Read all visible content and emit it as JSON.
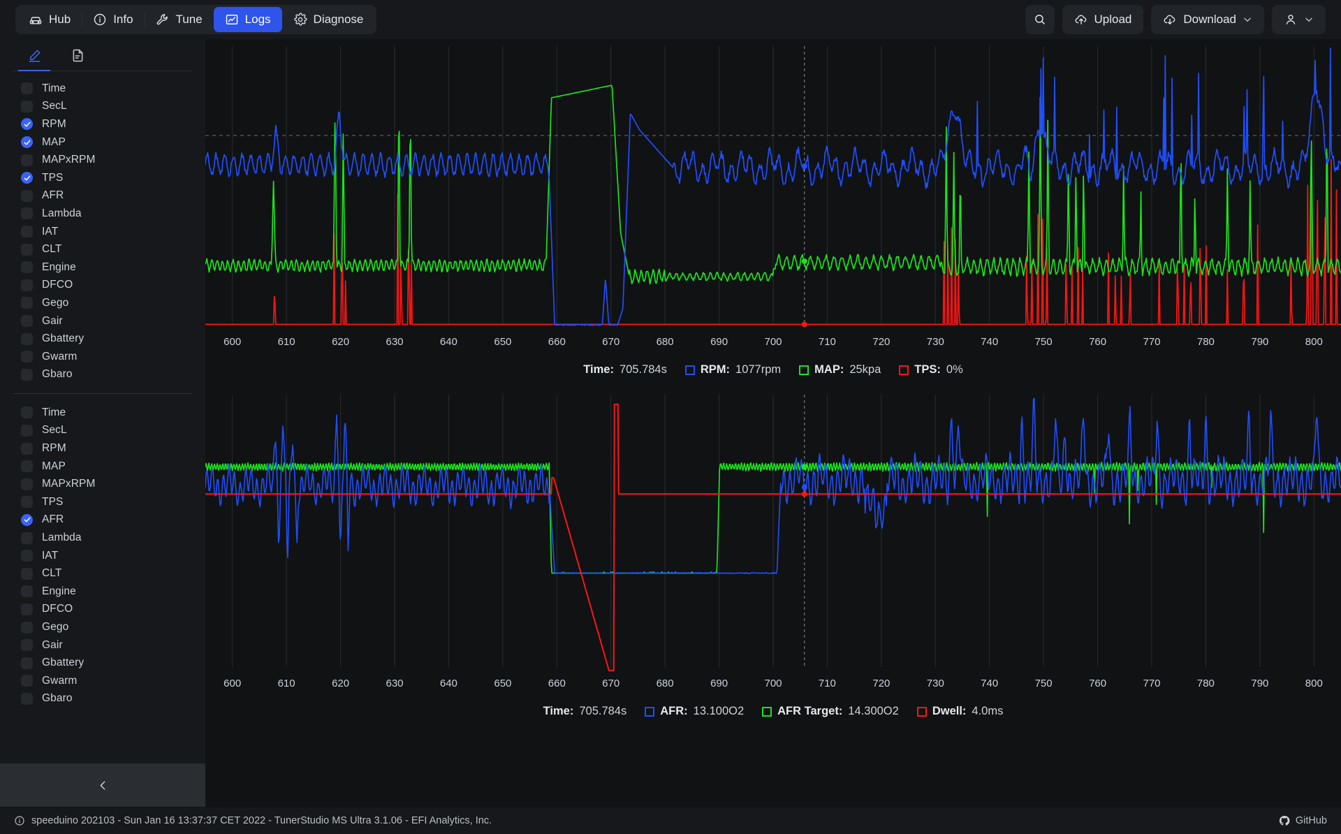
{
  "app": {
    "title": "Speeduino Logs Viewer",
    "accent": "#2f54eb",
    "background": "#101214",
    "panel": "#16181b"
  },
  "topbar": {
    "nav": [
      {
        "label": "Hub",
        "icon": "car-icon",
        "active": false
      },
      {
        "label": "Info",
        "icon": "info-circle-icon",
        "active": false
      },
      {
        "label": "Tune",
        "icon": "wrench-icon",
        "active": false
      },
      {
        "label": "Logs",
        "icon": "chart-line-icon",
        "active": true
      },
      {
        "label": "Diagnose",
        "icon": "gear-icon",
        "active": false
      }
    ],
    "actions": {
      "search_label": "",
      "search_icon": "search-icon",
      "upload_label": "Upload",
      "upload_icon": "cloud-upload-icon",
      "download_label": "Download",
      "download_icon": "cloud-download-icon",
      "download_chevron": "chevron-down-icon",
      "user_icon": "user-icon",
      "user_chevron": "chevron-down-icon"
    }
  },
  "sidebar": {
    "tabs": [
      {
        "icon": "pencil-icon",
        "active": true
      },
      {
        "icon": "file-icon",
        "active": false
      }
    ],
    "collapse_icon": "chevron-left-icon",
    "group_one": [
      {
        "label": "Time",
        "checked": false
      },
      {
        "label": "SecL",
        "checked": false
      },
      {
        "label": "RPM",
        "checked": true
      },
      {
        "label": "MAP",
        "checked": true
      },
      {
        "label": "MAPxRPM",
        "checked": false
      },
      {
        "label": "TPS",
        "checked": true
      },
      {
        "label": "AFR",
        "checked": false
      },
      {
        "label": "Lambda",
        "checked": false
      },
      {
        "label": "IAT",
        "checked": false
      },
      {
        "label": "CLT",
        "checked": false
      },
      {
        "label": "Engine",
        "checked": false
      },
      {
        "label": "DFCO",
        "checked": false
      },
      {
        "label": "Gego",
        "checked": false
      },
      {
        "label": "Gair",
        "checked": false
      },
      {
        "label": "Gbattery",
        "checked": false
      },
      {
        "label": "Gwarm",
        "checked": false
      },
      {
        "label": "Gbaro",
        "checked": false
      }
    ],
    "group_two": [
      {
        "label": "Time",
        "checked": false
      },
      {
        "label": "SecL",
        "checked": false
      },
      {
        "label": "RPM",
        "checked": false
      },
      {
        "label": "MAP",
        "checked": false
      },
      {
        "label": "MAPxRPM",
        "checked": false
      },
      {
        "label": "TPS",
        "checked": false
      },
      {
        "label": "AFR",
        "checked": true
      },
      {
        "label": "Lambda",
        "checked": false
      },
      {
        "label": "IAT",
        "checked": false
      },
      {
        "label": "CLT",
        "checked": false
      },
      {
        "label": "Engine",
        "checked": false
      },
      {
        "label": "DFCO",
        "checked": false
      },
      {
        "label": "Gego",
        "checked": false
      },
      {
        "label": "Gair",
        "checked": false
      },
      {
        "label": "Gbattery",
        "checked": false
      },
      {
        "label": "Gwarm",
        "checked": false
      },
      {
        "label": "Gbaro",
        "checked": false
      }
    ]
  },
  "chart_one_legend": {
    "time_label": "Time:",
    "time_value": "705.784s",
    "items": [
      {
        "name": "RPM:",
        "value": "1077rpm",
        "color": "#1f4fff"
      },
      {
        "name": "MAP:",
        "value": "25kpa",
        "color": "#19e519"
      },
      {
        "name": "TPS:",
        "value": "0%",
        "color": "#ff1414"
      }
    ]
  },
  "chart_two_legend": {
    "time_label": "Time:",
    "time_value": "705.784s",
    "items": [
      {
        "name": "AFR:",
        "value": "13.100O2",
        "color": "#1f4fff"
      },
      {
        "name": "AFR Target:",
        "value": "14.300O2",
        "color": "#19e519"
      },
      {
        "name": "Dwell:",
        "value": "4.0ms",
        "color": "#ff1414"
      }
    ]
  },
  "footer": {
    "info_icon": "info-circle-icon",
    "status": "speeduino 202103 - Sun Jan 16 13:37:37 CET 2022 - TunerStudio MS Ultra 3.1.06 - EFI Analytics, Inc.",
    "github_label": "GitHub",
    "github_icon": "github-icon"
  },
  "chart_data": [
    {
      "id": "chart-one",
      "type": "line",
      "title": "",
      "xlabel": "",
      "ylabel": "",
      "xlim": [
        595,
        805
      ],
      "xticks": [
        600,
        610,
        620,
        630,
        640,
        650,
        660,
        670,
        680,
        690,
        700,
        710,
        720,
        730,
        740,
        750,
        760,
        770,
        780,
        790,
        800
      ],
      "tick_labels": [
        "600",
        "610",
        "620",
        "630",
        "640",
        "650",
        "660",
        "670",
        "680",
        "690",
        "700",
        "710",
        "720",
        "730",
        "740",
        "750",
        "760",
        "770",
        "780",
        "790",
        "800"
      ],
      "grid": true,
      "legend_position": "bottom",
      "cursor": {
        "x": 705.784,
        "label": "705.784s",
        "style": "dashed-crosshair",
        "color": "#8a9099"
      },
      "hline": {
        "y_frac": 0.32,
        "style": "dashed",
        "color": "#8a9099"
      },
      "series": [
        {
          "name": "RPM",
          "color": "#1f4fff",
          "unit": "rpm",
          "value_at_cursor": 1077
        },
        {
          "name": "MAP",
          "color": "#19e519",
          "unit": "kpa",
          "value_at_cursor": 25
        },
        {
          "name": "TPS",
          "color": "#ff1414",
          "unit": "%",
          "value_at_cursor": 0
        }
      ]
    },
    {
      "id": "chart-two",
      "type": "line",
      "title": "",
      "xlabel": "",
      "ylabel": "",
      "xlim": [
        595,
        805
      ],
      "xticks": [
        600,
        610,
        620,
        630,
        640,
        650,
        660,
        670,
        680,
        690,
        700,
        710,
        720,
        730,
        740,
        750,
        760,
        770,
        780,
        790,
        800
      ],
      "tick_labels": [
        "600",
        "610",
        "620",
        "630",
        "640",
        "650",
        "660",
        "670",
        "680",
        "690",
        "700",
        "710",
        "720",
        "730",
        "740",
        "750",
        "760",
        "770",
        "780",
        "790",
        "800"
      ],
      "grid": true,
      "legend_position": "bottom",
      "cursor": {
        "x": 705.784,
        "label": "705.784s",
        "style": "dashed-crosshair",
        "color": "#8a9099"
      },
      "series": [
        {
          "name": "AFR",
          "color": "#1f4fff",
          "unit": "O2",
          "value_at_cursor": 13.1
        },
        {
          "name": "AFR Target",
          "color": "#19e519",
          "unit": "O2",
          "value_at_cursor": 14.3
        },
        {
          "name": "Dwell",
          "color": "#ff1414",
          "unit": "ms",
          "value_at_cursor": 4.0
        }
      ]
    }
  ]
}
